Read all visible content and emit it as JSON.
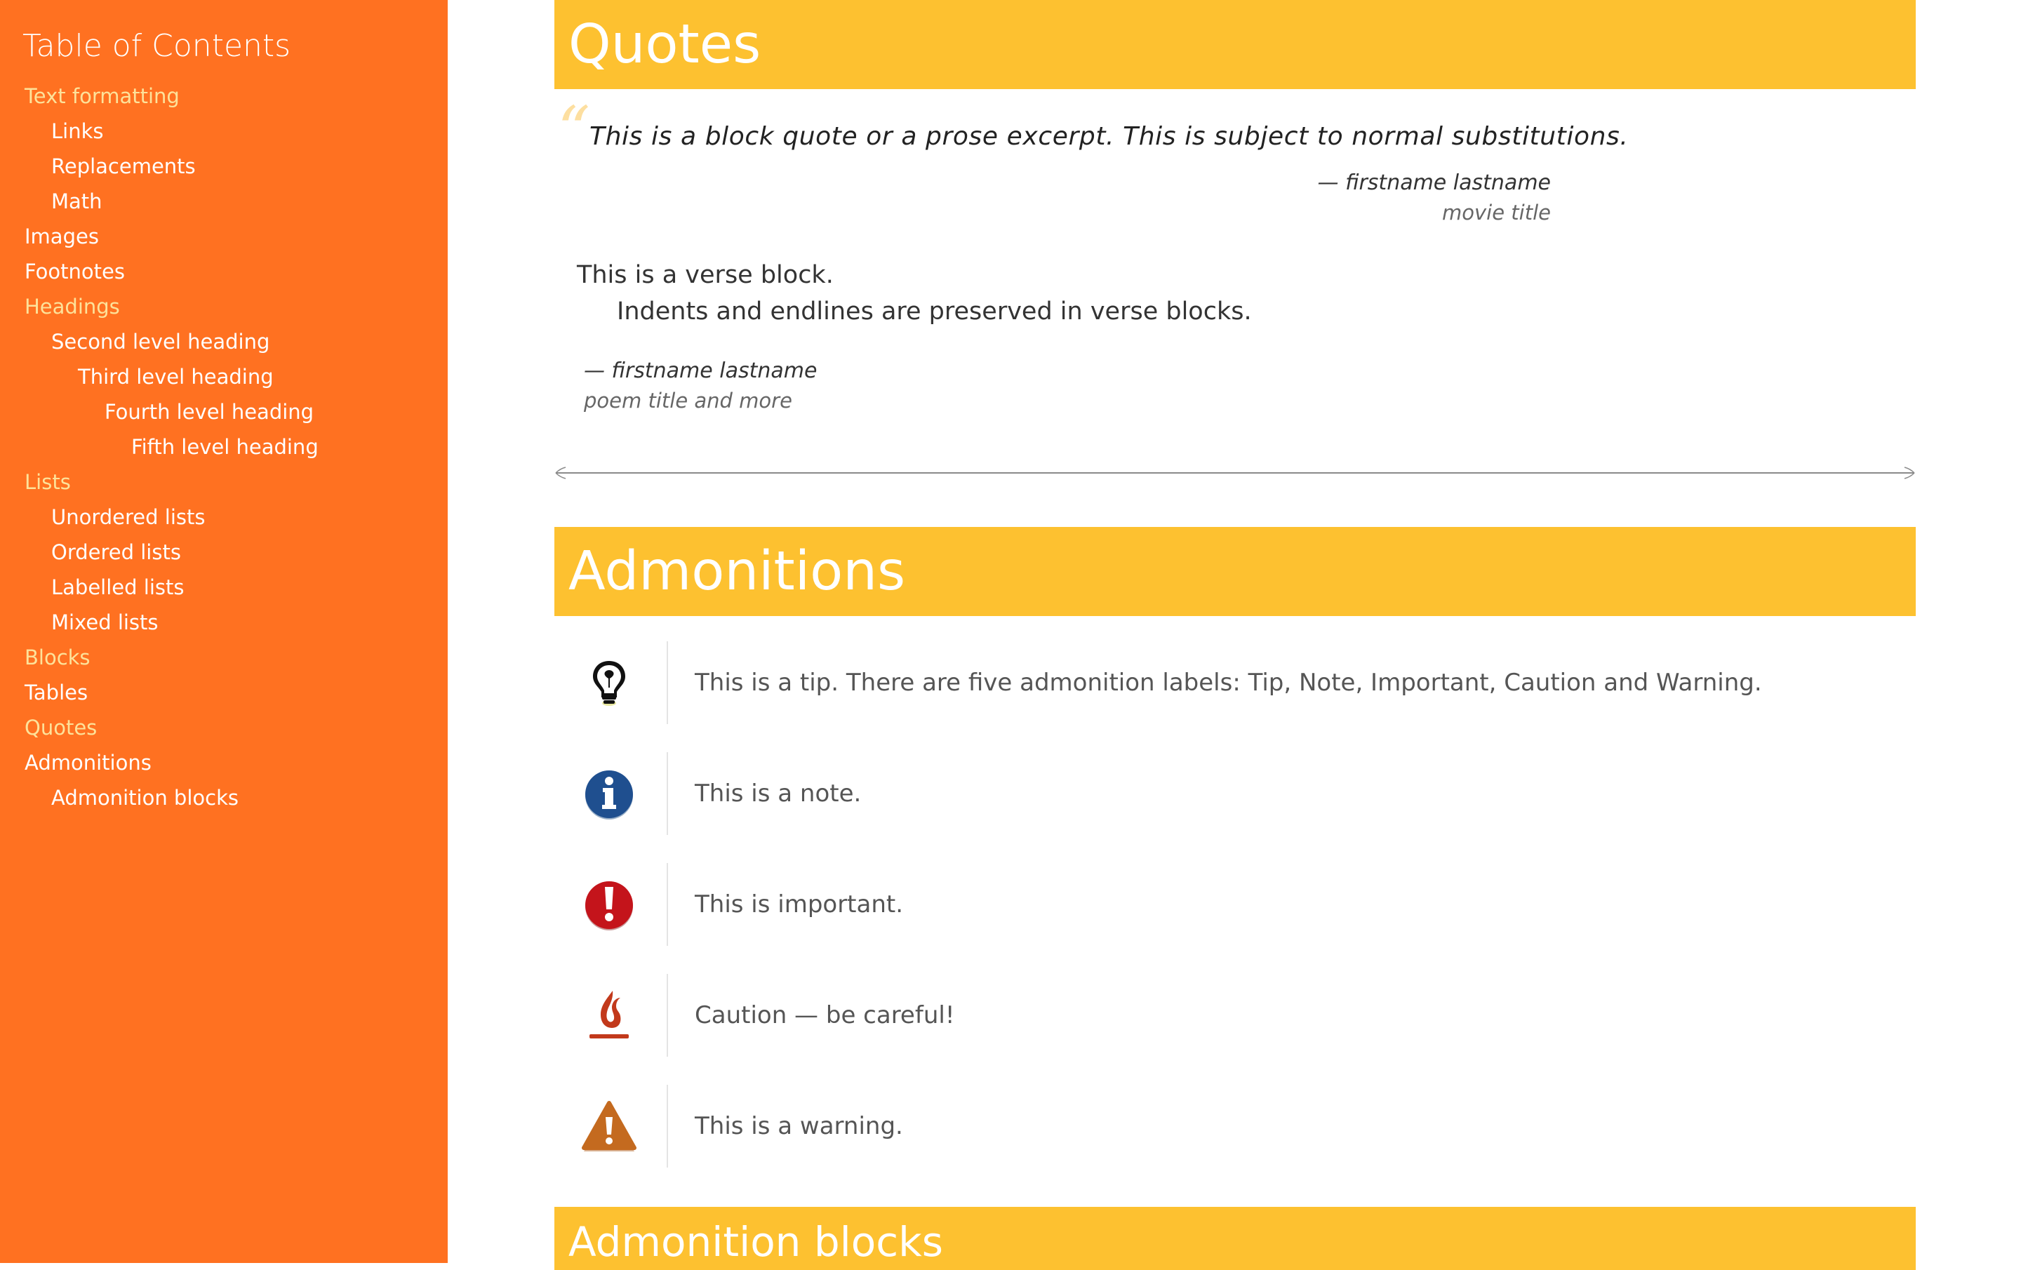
{
  "toc": {
    "title": "Table of Contents",
    "items": [
      {
        "label": "Text formatting",
        "level": 0,
        "accent": true
      },
      {
        "label": "Links",
        "level": 1,
        "accent": false
      },
      {
        "label": "Replacements",
        "level": 1,
        "accent": false
      },
      {
        "label": "Math",
        "level": 1,
        "accent": false
      },
      {
        "label": "Images",
        "level": 0,
        "accent": false
      },
      {
        "label": "Footnotes",
        "level": 0,
        "accent": false
      },
      {
        "label": "Headings",
        "level": 0,
        "accent": true
      },
      {
        "label": "Second level heading",
        "level": 1,
        "accent": false
      },
      {
        "label": "Third level heading",
        "level": 2,
        "accent": false
      },
      {
        "label": "Fourth level heading",
        "level": 3,
        "accent": false
      },
      {
        "label": "Fifth level heading",
        "level": 4,
        "accent": false
      },
      {
        "label": "Lists",
        "level": 0,
        "accent": true
      },
      {
        "label": "Unordered lists",
        "level": 1,
        "accent": false
      },
      {
        "label": "Ordered lists",
        "level": 1,
        "accent": false
      },
      {
        "label": "Labelled lists",
        "level": 1,
        "accent": false
      },
      {
        "label": "Mixed lists",
        "level": 1,
        "accent": false
      },
      {
        "label": "Blocks",
        "level": 0,
        "accent": true
      },
      {
        "label": "Tables",
        "level": 0,
        "accent": false
      },
      {
        "label": "Quotes",
        "level": 0,
        "accent": true
      },
      {
        "label": "Admonitions",
        "level": 0,
        "accent": false
      },
      {
        "label": "Admonition blocks",
        "level": 1,
        "accent": false
      }
    ]
  },
  "quotes": {
    "heading": "Quotes",
    "blockquote": {
      "text": "This is a block quote or a prose excerpt. This is subject to normal substitutions.",
      "attribution": "— firstname lastname",
      "citation": "movie title"
    },
    "verse": {
      "line1": "This is a verse block.",
      "line2": "Indents and endlines are preserved in verse blocks.",
      "attribution": "— firstname lastname",
      "citation": "poem title and more"
    }
  },
  "admonitions": {
    "heading": "Admonitions",
    "items": [
      {
        "type": "tip",
        "icon": "lightbulb-icon",
        "text": "This is a tip. There are five admonition labels: Tip, Note, Important, Caution and Warning."
      },
      {
        "type": "note",
        "icon": "info-icon",
        "text": "This is a note."
      },
      {
        "type": "important",
        "icon": "exclamation-icon",
        "text": "This is important."
      },
      {
        "type": "caution",
        "icon": "flame-icon",
        "text": "Caution — be careful!"
      },
      {
        "type": "warning",
        "icon": "warning-triangle-icon",
        "text": "This is a warning."
      }
    ]
  },
  "admonition_blocks": {
    "heading": "Admonition blocks"
  },
  "colors": {
    "sidebar_bg": "#ff7121",
    "banner_bg": "#fdc130",
    "toc_accent": "#fde29a",
    "note_blue": "#1f4f8f",
    "important_red": "#c4141b",
    "caution_red": "#c2391b",
    "warning_orange": "#c46a1f"
  }
}
